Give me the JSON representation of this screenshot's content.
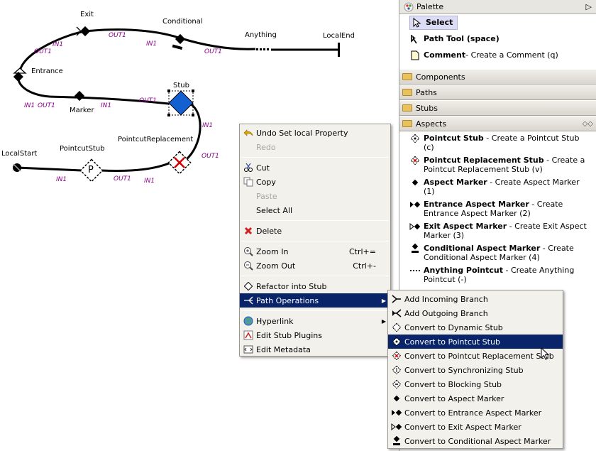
{
  "canvas": {
    "nodes": {
      "exit": "Exit",
      "conditional": "Conditional",
      "anything": "Anything",
      "local_end": "LocalEnd",
      "entrance": "Entrance",
      "stub": "Stub",
      "marker": "Marker",
      "pointcut_replacement": "PointcutReplacement",
      "local_start": "LocalStart",
      "pointcut_stub": "PointcutStub",
      "pointcut_stub_glyph": "P"
    },
    "io": {
      "out1": "OUT1",
      "in1": "IN1"
    }
  },
  "palette": {
    "title": "Palette",
    "tools": [
      {
        "name": "Select"
      },
      {
        "name": "Path Tool (space)"
      },
      {
        "name": "Comment",
        "desc": " - Create a Comment (q)"
      }
    ],
    "drawers": [
      "Components",
      "Paths",
      "Stubs",
      "Aspects"
    ],
    "aspect_tools": [
      {
        "name": "Pointcut Stub",
        "desc": " - Create a Pointcut Stub (c)"
      },
      {
        "name": "Pointcut Replacement Stub",
        "desc": " - Create a Pointcut Replacement Stub (v)"
      },
      {
        "name": "Aspect Marker",
        "desc": " - Create Aspect Marker (1)"
      },
      {
        "name": "Entrance Aspect Marker",
        "desc": " - Create Entrance Aspect Marker (2)"
      },
      {
        "name": "Exit Aspect Marker",
        "desc": " - Create Exit Aspect Marker (3)"
      },
      {
        "name": "Conditional Aspect Marker",
        "desc": " - Create Conditional Aspect Marker (4)"
      },
      {
        "name": "Anything Pointcut",
        "desc": " - Create Anything Pointcut (-)"
      }
    ]
  },
  "context_menu": {
    "undo": "Undo Set local Property",
    "redo": "Redo",
    "cut": "Cut",
    "copy": "Copy",
    "paste": "Paste",
    "select_all": "Select All",
    "delete": "Delete",
    "zoom_in": "Zoom In",
    "zoom_in_sc": "Ctrl+=",
    "zoom_out": "Zoom Out",
    "zoom_out_sc": "Ctrl+-",
    "refactor": "Refactor into Stub",
    "path_ops": "Path Operations",
    "hyperlink": "Hyperlink",
    "edit_stub_plugins": "Edit Stub Plugins",
    "edit_metadata": "Edit Metadata"
  },
  "submenu": [
    "Add Incoming Branch",
    "Add Outgoing Branch",
    "Convert to Dynamic Stub",
    "Convert to Pointcut Stub",
    "Convert to Pointcut Replacement Stub",
    "Convert to Synchronizing Stub",
    "Convert to Blocking Stub",
    "Convert to Aspect Marker",
    "Convert to Entrance Aspect Marker",
    "Convert to Exit Aspect Marker",
    "Convert to Conditional Aspect Marker"
  ],
  "colors": {
    "menu_highlight": "#0a246a",
    "io_label": "#8b008b",
    "stub_fill": "#1560d0"
  }
}
